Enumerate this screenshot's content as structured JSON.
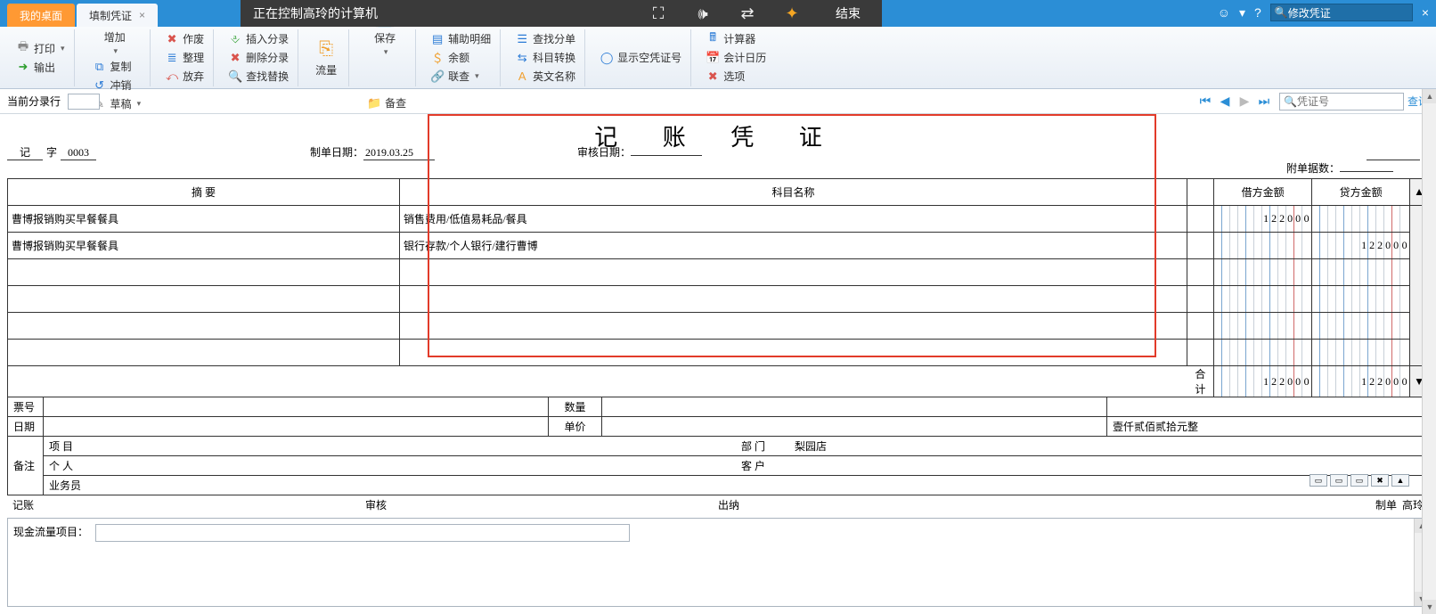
{
  "remote": {
    "text": "正在控制高玲的计算机",
    "end": "结束"
  },
  "tabs": {
    "home": "我的桌面",
    "active": "填制凭证"
  },
  "topSearch": {
    "placeholder": "修改凭证"
  },
  "ribbon": {
    "print": "打印",
    "export": "输出",
    "add": "增加",
    "copy": "复制",
    "offset": "冲销",
    "draft": "草稿",
    "void": "作废",
    "tidy": "整理",
    "discard": "放弃",
    "insertLine": "插入分录",
    "deleteLine": "删除分录",
    "findReplace": "查找替换",
    "flow": "流量",
    "save": "保存",
    "backup": "备查",
    "auxDetail": "辅助明细",
    "balance": "余额",
    "link": "联查",
    "findSplit": "查找分单",
    "acctSwitch": "科目转换",
    "engName": "英文名称",
    "showEmpty": "显示空凭证号",
    "calc": "计算器",
    "calendar": "会计日历",
    "options": "选项"
  },
  "secbar": {
    "currentLine": "当前分录行",
    "voucherNoPH": "凭证号",
    "query": "查询"
  },
  "voucher": {
    "title": "记 账 凭 证",
    "prefix": "记",
    "wordSuffix": "字",
    "number": "0003",
    "makeDateLabel": "制单日期：",
    "makeDate": "2019.03.25",
    "auditDateLabel": "审核日期：",
    "auditDate": "",
    "attachLabel": "附单据数：",
    "headers": {
      "summary": "摘  要",
      "account": "科目名称",
      "debit": "借方金额",
      "credit": "贷方金额"
    },
    "rows": [
      {
        "summary": "曹博报销购买早餐餐具",
        "account": "销售费用/低值易耗品/餐具",
        "debit": "122000",
        "credit": ""
      },
      {
        "summary": "曹博报销购买早餐餐具",
        "account": "银行存款/个人银行/建行曹博",
        "debit": "",
        "credit": "122000"
      }
    ],
    "billNoLabel": "票号",
    "dateLabel": "日期",
    "qtyLabel": "数量",
    "priceLabel": "单价",
    "totalLabel": "合  计",
    "totalDebit": "122000",
    "totalCredit": "122000",
    "amountWords": "壹仟贰佰贰拾元整",
    "remarkLabel": "备注",
    "projectLabel": "项  目",
    "deptLabel": "部  门",
    "deptValue": "梨园店",
    "personLabel": "个  人",
    "custLabel": "客  户",
    "salesLabel": "业务员",
    "sig": {
      "book": "记账",
      "audit": "审核",
      "cashier": "出纳",
      "maker": "制单",
      "makerName": "高玲"
    }
  },
  "cashflow": {
    "label": "现金流量项目："
  }
}
